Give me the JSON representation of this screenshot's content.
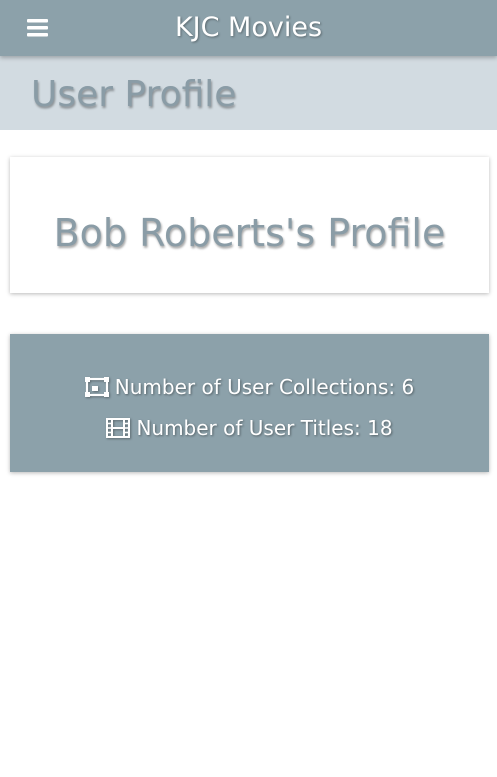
{
  "app": {
    "title": "KJC Movies",
    "menu_icon": "hamburger-menu-icon"
  },
  "page": {
    "title": "User Profile"
  },
  "profile": {
    "heading": "Bob Roberts's Profile"
  },
  "stats": [
    {
      "icon": "collection-frame-icon",
      "label": "Number of User Collections: 6"
    },
    {
      "icon": "film-strip-icon",
      "label": "Number of User Titles: 18"
    }
  ],
  "colors": {
    "navbar": "#8ca1aa",
    "header_band": "#d2dbe1",
    "heading_text": "#8a9ca6",
    "stats_card": "#8ca1aa"
  }
}
